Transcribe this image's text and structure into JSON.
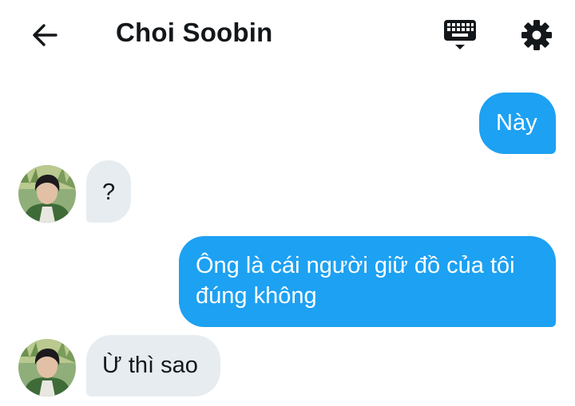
{
  "header": {
    "title": "Choi Soobin",
    "back_icon": "arrow-left-icon",
    "keyboard_icon": "keyboard-icon",
    "settings_icon": "gear-icon"
  },
  "colors": {
    "sent_bubble": "#1da1f2",
    "received_bubble": "#e6ecf0",
    "text_dark": "#14171a"
  },
  "messages": [
    {
      "direction": "sent",
      "text": "Này"
    },
    {
      "direction": "received",
      "text": "?"
    },
    {
      "direction": "sent",
      "text": "Ông là cái người giữ đồ của tôi đúng không"
    },
    {
      "direction": "received",
      "text": "Ừ thì sao"
    }
  ]
}
